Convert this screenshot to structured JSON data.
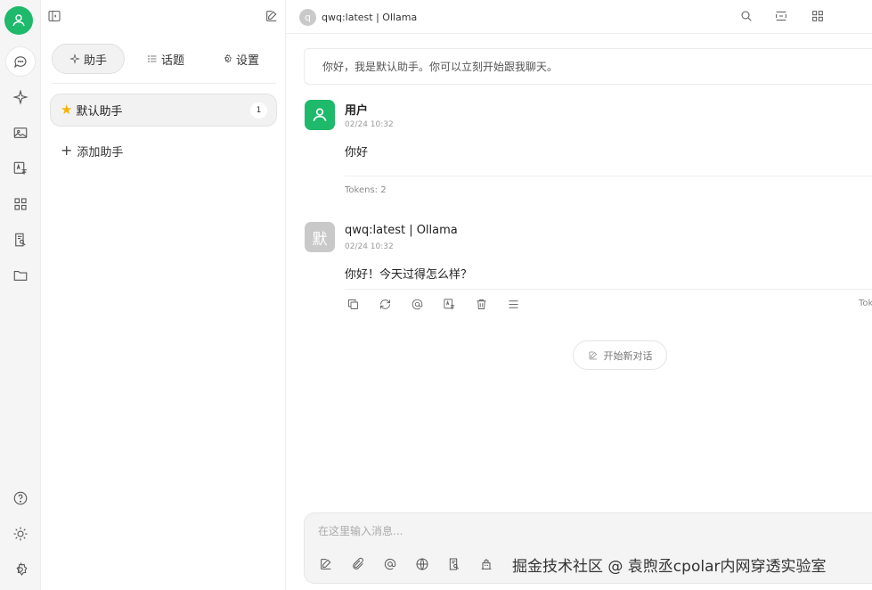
{
  "app": {
    "model_title": "qwq:latest | Ollama",
    "model_initial": "q"
  },
  "rail": {
    "items": [
      {
        "icon": "chat-icon"
      },
      {
        "icon": "sparkle-icon"
      },
      {
        "icon": "image-icon"
      },
      {
        "icon": "translate-icon"
      },
      {
        "icon": "apps-icon"
      },
      {
        "icon": "knowledge-icon"
      },
      {
        "icon": "folder-icon"
      }
    ],
    "bottom": [
      {
        "icon": "help-icon"
      },
      {
        "icon": "theme-icon"
      },
      {
        "icon": "settings-icon"
      }
    ]
  },
  "panel": {
    "tabs": [
      {
        "label": "助手",
        "icon": "sparkle-icon",
        "active": true
      },
      {
        "label": "话题",
        "icon": "list-icon",
        "active": false
      },
      {
        "label": "设置",
        "icon": "gear-icon",
        "active": false
      }
    ],
    "assistant": {
      "label": "默认助手",
      "count": "1",
      "icon": "star-icon"
    },
    "add_label": "添加助手"
  },
  "chat": {
    "greeting": "你好，我是默认助手。你可以立刻开始跟我聊天。",
    "messages": [
      {
        "role": "user",
        "name": "用户",
        "time": "02/24 10:32",
        "text": "你好",
        "tokens": "Tokens: 2"
      },
      {
        "role": "assistant",
        "name": "qwq:latest | Ollama",
        "avatar": "默",
        "time": "02/24 10:32",
        "text": "你好！今天过得怎么样？",
        "tokens_cut": "Tok"
      }
    ],
    "new_chat_label": "开始新对话"
  },
  "composer": {
    "placeholder": "在这里输入消息..."
  },
  "watermark": "掘金技术社区 @ 袁煦丞cpolar内网穿透实验室",
  "colors": {
    "accent": "#1eb96b",
    "star": "#f4b400",
    "bot_avatar": "#c9c9c9"
  }
}
